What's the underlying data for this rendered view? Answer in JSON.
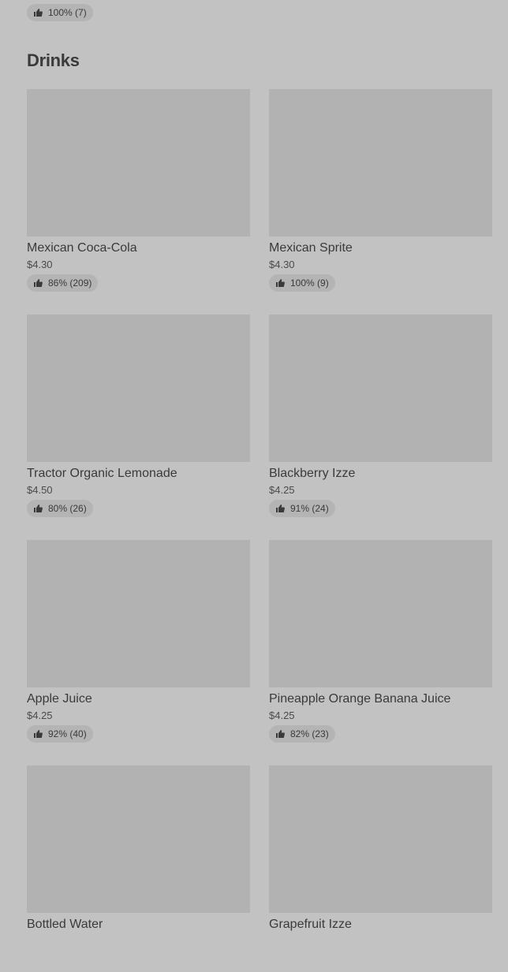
{
  "previous_item": {
    "rating": "100% (7)"
  },
  "section": {
    "title": "Drinks"
  },
  "items": [
    {
      "name": "Mexican Coca-Cola",
      "price": "$4.30",
      "rating": "86% (209)"
    },
    {
      "name": "Mexican Sprite",
      "price": "$4.30",
      "rating": "100% (9)"
    },
    {
      "name": "Tractor Organic Lemonade",
      "price": "$4.50",
      "rating": "80% (26)"
    },
    {
      "name": "Blackberry Izze",
      "price": "$4.25",
      "rating": "91% (24)"
    },
    {
      "name": "Apple Juice",
      "price": "$4.25",
      "rating": "92% (40)"
    },
    {
      "name": "Pineapple Orange Banana Juice",
      "price": "$4.25",
      "rating": "82% (23)"
    },
    {
      "name": "Bottled Water",
      "price": "",
      "rating": ""
    },
    {
      "name": "Grapefruit Izze",
      "price": "",
      "rating": ""
    }
  ],
  "icons": {
    "rating": "thumbs-up-icon"
  },
  "colors": {
    "background": "#c2c2c2",
    "image_placeholder": "#b2b2b2",
    "badge_background": "#b4b4b4",
    "text": "#3a3a3a"
  }
}
